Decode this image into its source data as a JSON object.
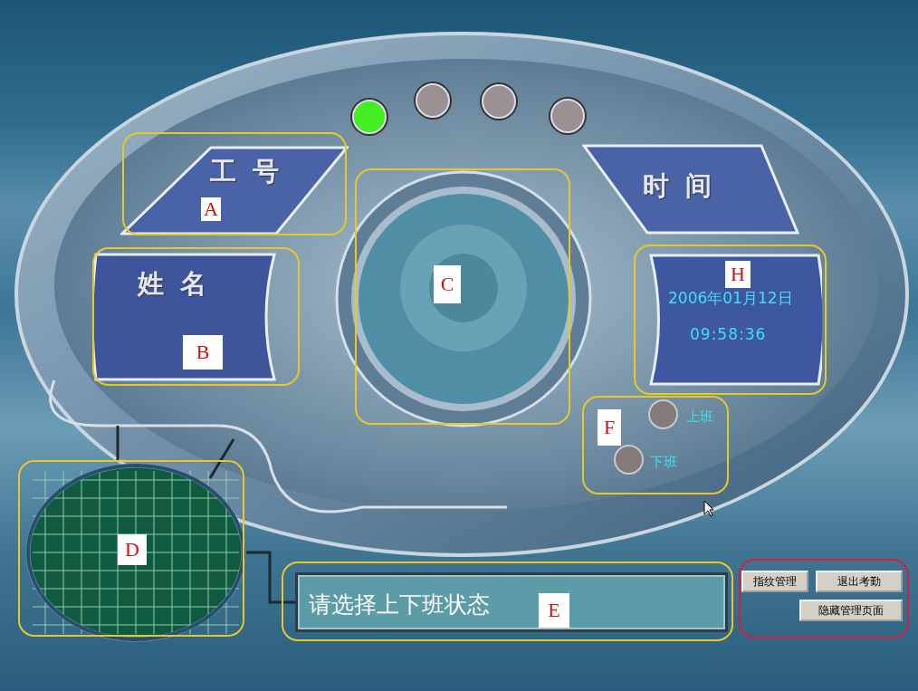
{
  "indicator_lights": [
    {
      "on": true
    },
    {
      "on": false
    },
    {
      "on": false
    },
    {
      "on": false
    }
  ],
  "id_panel": {
    "label": "工 号",
    "marker": "A"
  },
  "name_panel": {
    "label": "姓 名",
    "marker": "B"
  },
  "fingerprint_window": {
    "marker": "C"
  },
  "grid_display": {
    "marker": "D"
  },
  "message_display": {
    "text": "请选择上下班状态",
    "marker": "E"
  },
  "shift_selector": {
    "marker": "F",
    "options": [
      {
        "label": "上班",
        "selected": false
      },
      {
        "label": "下班",
        "selected": false
      }
    ]
  },
  "time_panel": {
    "label": "时 间"
  },
  "clock_display": {
    "marker": "H",
    "date": "2006年01月12日",
    "time": "09:58:36"
  },
  "buttons": [
    {
      "label": "指纹管理"
    },
    {
      "label": "退出考勤"
    },
    {
      "label": "隐藏管理页面"
    }
  ]
}
